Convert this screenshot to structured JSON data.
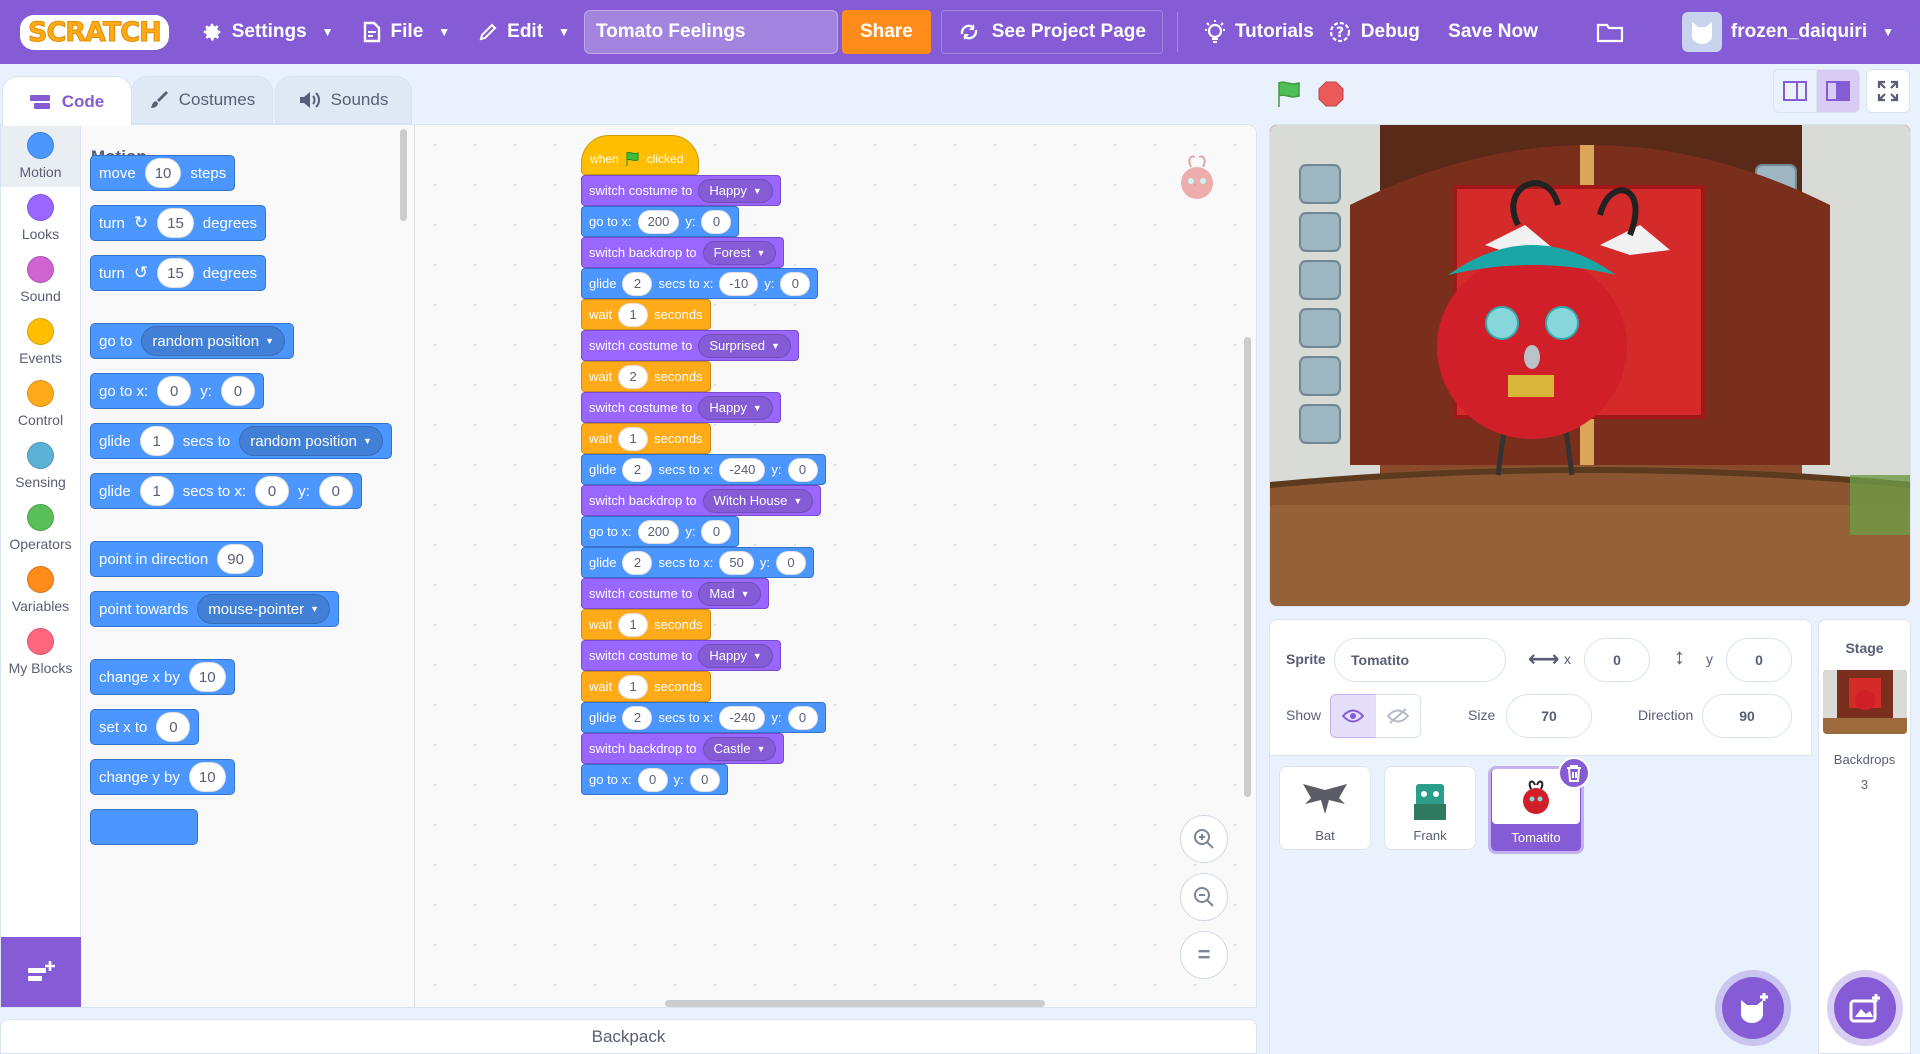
{
  "menu": {
    "logo": "SCRATCH",
    "settings": "Settings",
    "file": "File",
    "edit": "Edit",
    "project_title": "Tomato Feelings",
    "share": "Share",
    "see_project": "See Project Page",
    "tutorials": "Tutorials",
    "debug": "Debug",
    "save_now": "Save Now",
    "username": "frozen_daiquiri"
  },
  "tabs": {
    "code": "Code",
    "costumes": "Costumes",
    "sounds": "Sounds"
  },
  "categories": [
    {
      "label": "Motion",
      "color": "#4c97ff"
    },
    {
      "label": "Looks",
      "color": "#9966ff"
    },
    {
      "label": "Sound",
      "color": "#cf63cf"
    },
    {
      "label": "Events",
      "color": "#ffbf00"
    },
    {
      "label": "Control",
      "color": "#ffab19"
    },
    {
      "label": "Sensing",
      "color": "#5cb1d6"
    },
    {
      "label": "Operators",
      "color": "#59c059"
    },
    {
      "label": "Variables",
      "color": "#ff8c1a"
    },
    {
      "label": "My Blocks",
      "color": "#ff6680"
    }
  ],
  "palette": {
    "heading": "Motion",
    "move": {
      "a": "move",
      "n": "10",
      "b": "steps"
    },
    "turn_right": {
      "a": "turn",
      "n": "15",
      "b": "degrees"
    },
    "turn_left": {
      "a": "turn",
      "n": "15",
      "b": "degrees"
    },
    "goto_random": {
      "a": "go to",
      "dd": "random position"
    },
    "goto_xy": {
      "a": "go to x:",
      "x": "0",
      "y_label": "y:",
      "y": "0"
    },
    "glide_random": {
      "a": "glide",
      "n": "1",
      "b": "secs to",
      "dd": "random position"
    },
    "glide_xy": {
      "a": "glide",
      "n": "1",
      "b": "secs to x:",
      "x": "0",
      "y_label": "y:",
      "y": "0"
    },
    "point_dir": {
      "a": "point in direction",
      "n": "90"
    },
    "point_towards": {
      "a": "point towards",
      "dd": "mouse-pointer"
    },
    "change_x": {
      "a": "change x by",
      "n": "10"
    },
    "set_x": {
      "a": "set x to",
      "n": "0"
    },
    "change_y": {
      "a": "change y by",
      "n": "10"
    }
  },
  "script": {
    "hat": {
      "when": "when",
      "clicked": "clicked"
    },
    "costume_label": "switch costume to",
    "backdrop_label": "switch backdrop to",
    "goto_label": "go to x:",
    "y_label": "y:",
    "glide_label": "glide",
    "secs_to_x": "secs to x:",
    "wait_label": "wait",
    "seconds": "seconds",
    "b1": {
      "costume": "Happy"
    },
    "b2": {
      "x": "200",
      "y": "0"
    },
    "b3": {
      "backdrop": "Forest"
    },
    "b4": {
      "secs": "2",
      "x": "-10",
      "y": "0"
    },
    "b5": {
      "secs": "1"
    },
    "b6": {
      "costume": "Surprised"
    },
    "b7": {
      "secs": "2"
    },
    "b8": {
      "costume": "Happy"
    },
    "b9": {
      "secs": "1"
    },
    "b10": {
      "secs": "2",
      "x": "-240",
      "y": "0"
    },
    "b11": {
      "backdrop": "Witch House"
    },
    "b12": {
      "x": "200",
      "y": "0"
    },
    "b13": {
      "secs": "2",
      "x": "50",
      "y": "0"
    },
    "b14": {
      "costume": "Mad"
    },
    "b15": {
      "secs": "1"
    },
    "b16": {
      "costume": "Happy"
    },
    "b17": {
      "secs": "1"
    },
    "b18": {
      "secs": "2",
      "x": "-240",
      "y": "0"
    },
    "b19": {
      "backdrop": "Castle"
    },
    "b20": {
      "x": "0",
      "y": "0"
    }
  },
  "backpack": "Backpack",
  "sprite_info": {
    "sprite_label": "Sprite",
    "sprite_name": "Tomatito",
    "x_label": "x",
    "x": "0",
    "y_label": "y",
    "y": "0",
    "show_label": "Show",
    "size_label": "Size",
    "size": "70",
    "direction_label": "Direction",
    "direction": "90"
  },
  "sprites": [
    {
      "name": "Bat",
      "selected": false
    },
    {
      "name": "Frank",
      "selected": false
    },
    {
      "name": "Tomatito",
      "selected": true
    }
  ],
  "stage_pane": {
    "title": "Stage",
    "backdrops_label": "Backdrops",
    "backdrops_count": "3"
  }
}
